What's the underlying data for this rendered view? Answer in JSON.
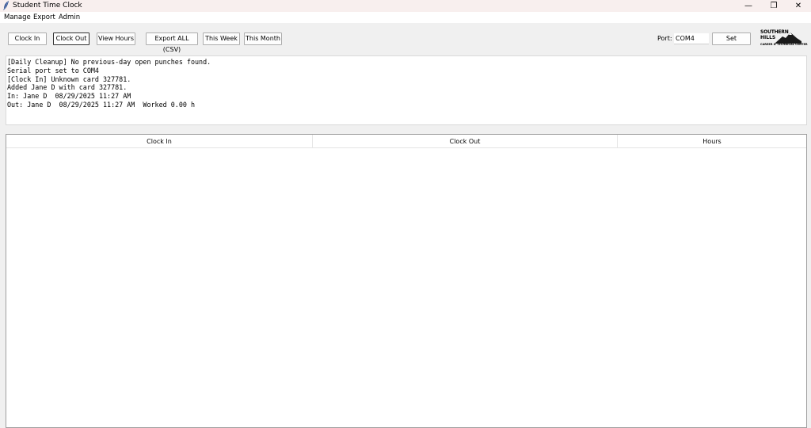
{
  "window": {
    "title": "Student Time Clock",
    "minimize_glyph": "—",
    "maximize_glyph": "❐",
    "close_glyph": "✕"
  },
  "menu": [
    "Manage",
    "Export",
    "Admin"
  ],
  "toolbar": {
    "buttons": [
      "Clock In",
      "Clock Out",
      "View Hours",
      "Export ALL (CSV)",
      "This Week",
      "This Month"
    ],
    "port_label": "Port:",
    "port_value": "COM4",
    "set_label": "Set"
  },
  "logo": {
    "line1": "SOUTHERN",
    "line2": "HILLS",
    "line3": "CAREER & TECHNICAL CENTER"
  },
  "log_lines": [
    "[Daily Cleanup] No previous-day open punches found.",
    "Serial port set to COM4",
    "[Clock In] Unknown card 327781.",
    "Added Jane D with card 327781.",
    "In: Jane D  08/29/2025 11:27 AM",
    "Out: Jane D  08/29/2025 11:27 AM  Worked 0.00 h"
  ],
  "table": {
    "columns": [
      "Clock In",
      "Clock Out",
      "Hours"
    ],
    "rows": []
  }
}
